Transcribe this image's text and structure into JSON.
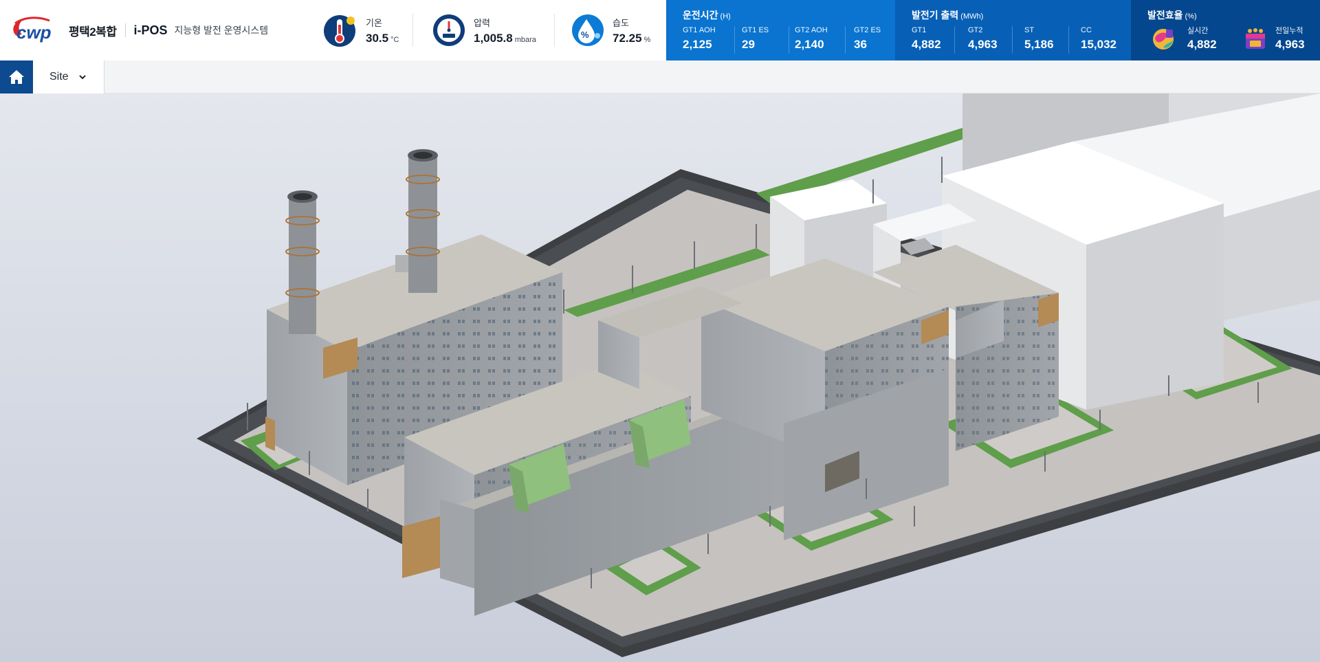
{
  "brand": {
    "logo_text": "cwp",
    "plant_name": "평택2복합",
    "product": "i-POS",
    "product_desc": "지능형 발전 운영시스템"
  },
  "weather": {
    "temperature": {
      "label": "기온",
      "value": "30.5",
      "unit": "°C",
      "icon": "thermometer-icon"
    },
    "pressure": {
      "label": "압력",
      "value": "1,005.8",
      "unit": "mbara",
      "icon": "gauge-icon"
    },
    "humidity": {
      "label": "습도",
      "value": "72.25",
      "unit": "%",
      "icon": "humidity-drop-icon"
    }
  },
  "operating_hours": {
    "title": "운전시간",
    "unit": "(H)",
    "items": [
      {
        "label": "GT1 AOH",
        "value": "2,125"
      },
      {
        "label": "GT1 ES",
        "value": "29"
      },
      {
        "label": "GT2 AOH",
        "value": "2,140"
      },
      {
        "label": "GT2 ES",
        "value": "36"
      }
    ]
  },
  "generator_output": {
    "title": "발전기 출력",
    "unit": "(MWh)",
    "items": [
      {
        "label": "GT1",
        "value": "4,882"
      },
      {
        "label": "GT2",
        "value": "4,963"
      },
      {
        "label": "ST",
        "value": "5,186"
      },
      {
        "label": "CC",
        "value": "15,032"
      }
    ]
  },
  "efficiency": {
    "title": "발전효율",
    "unit": "(%)",
    "items": [
      {
        "label": "실시간",
        "value": "4,882",
        "icon": "realtime-globe-icon"
      },
      {
        "label": "전일누적",
        "value": "4,963",
        "icon": "calendar-accumulated-icon"
      }
    ]
  },
  "colors": {
    "panel_hours": "#0a74d0",
    "panel_output": "#0760b6",
    "panel_efficiency": "#05478f",
    "nav_home": "#0d4a8f"
  },
  "nav": {
    "home_icon": "home-icon",
    "site_label": "Site"
  }
}
